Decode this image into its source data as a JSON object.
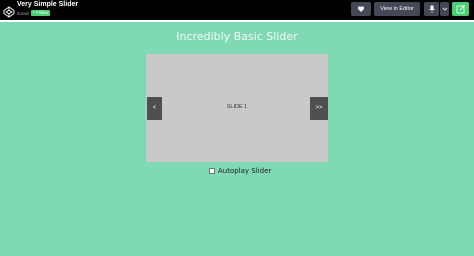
{
  "header": {
    "title": "Very Simple Slider",
    "author": "zuraiz",
    "follow_label": "+ Follow",
    "view_in_editor_label": "View in Editor",
    "icons": [
      "codepen-logo-icon",
      "heart-icon",
      "pin-icon",
      "chevron-down-icon",
      "edit-icon"
    ],
    "accent_color": "#47cf73"
  },
  "page": {
    "title": "Incredibly Basic Slider",
    "background": "#7fd9b3"
  },
  "slider": {
    "slide_label": "SLIDE 1",
    "prev_label": "<",
    "next_label": ">>"
  },
  "autoplay": {
    "label": "Autoplay Slider",
    "checked": false
  }
}
